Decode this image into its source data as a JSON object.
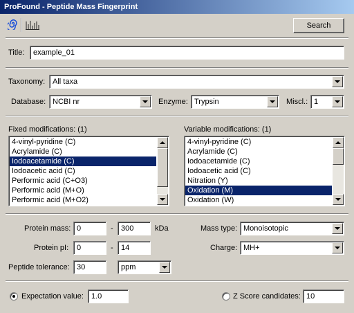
{
  "window": {
    "title": "ProFound - Peptide Mass Fingerprint"
  },
  "toolbar": {
    "icons": [
      "spiral-icon",
      "spectrum-icon"
    ],
    "search_label": "Search"
  },
  "title_field": {
    "label": "Title:",
    "value": "example_01"
  },
  "taxonomy": {
    "label": "Taxonomy:",
    "value": "All taxa"
  },
  "database": {
    "label": "Database:",
    "value": "NCBI nr"
  },
  "enzyme": {
    "label": "Enzyme:",
    "value": "Trypsin"
  },
  "miscl": {
    "label": "Miscl.:",
    "value": "1"
  },
  "fixed_mods": {
    "label": "Fixed modifications: (1)",
    "items": [
      "4-vinyl-pyridine (C)",
      "Acrylamide (C)",
      "Iodoacetamide (C)",
      "Iodoacetic acid (C)",
      "Performic acid (C+O3)",
      "Performic acid (M+O)",
      "Performic acid (M+O2)"
    ],
    "selected": "Iodoacetamide (C)"
  },
  "variable_mods": {
    "label": "Variable modifications: (1)",
    "items": [
      "4-vinyl-pyridine (C)",
      "Acrylamide (C)",
      "Iodoacetamide (C)",
      "Iodoacetic acid (C)",
      "Nitration (Y)",
      "Oxidation (M)",
      "Oxidation (W)"
    ],
    "selected": "Oxidation (M)"
  },
  "protein_mass": {
    "label": "Protein mass:",
    "min": "0",
    "sep": "-",
    "max": "300",
    "unit": "kDa"
  },
  "protein_pi": {
    "label": "Protein pI:",
    "min": "0",
    "sep": "-",
    "max": "14"
  },
  "peptide_tolerance": {
    "label": "Peptide tolerance:",
    "value": "30",
    "unit": "ppm"
  },
  "mass_type": {
    "label": "Mass type:",
    "value": "Monoisotopic"
  },
  "charge": {
    "label": "Charge:",
    "value": "MH+"
  },
  "expectation": {
    "label": "Expectation value:",
    "value": "1.0",
    "selected": true
  },
  "zscore": {
    "label": "Z Score candidates:",
    "value": "10",
    "selected": false
  }
}
